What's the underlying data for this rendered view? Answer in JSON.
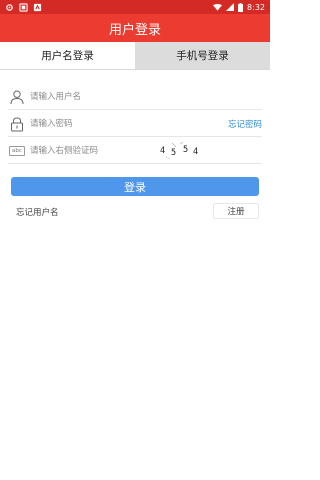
{
  "status_bar": {
    "time": "8:32",
    "colors": {
      "background": "#d42a25"
    },
    "left_icons": [
      "settings-icon",
      "notification-icon",
      "app-icon"
    ],
    "right_icons": [
      "wifi-icon",
      "signal-icon",
      "battery-icon"
    ]
  },
  "header": {
    "title": "用户登录",
    "color": "#ec3b30"
  },
  "tabs": [
    {
      "label": "用户名登录",
      "active": true
    },
    {
      "label": "手机号登录",
      "active": false
    }
  ],
  "form": {
    "username": {
      "placeholder": "请输入用户名",
      "value": ""
    },
    "password": {
      "placeholder": "请输入密码",
      "value": ""
    },
    "forgot_password": "忘记密码",
    "captcha_input": {
      "placeholder": "请输入右侧验证码",
      "value": "",
      "icon_text": "abc"
    },
    "captcha_code": [
      "4",
      "5",
      "5",
      "4"
    ]
  },
  "actions": {
    "login_label": "登录",
    "login_color": "#4f97ea",
    "forgot_username": "忘记用户名",
    "register_label": "注册"
  }
}
